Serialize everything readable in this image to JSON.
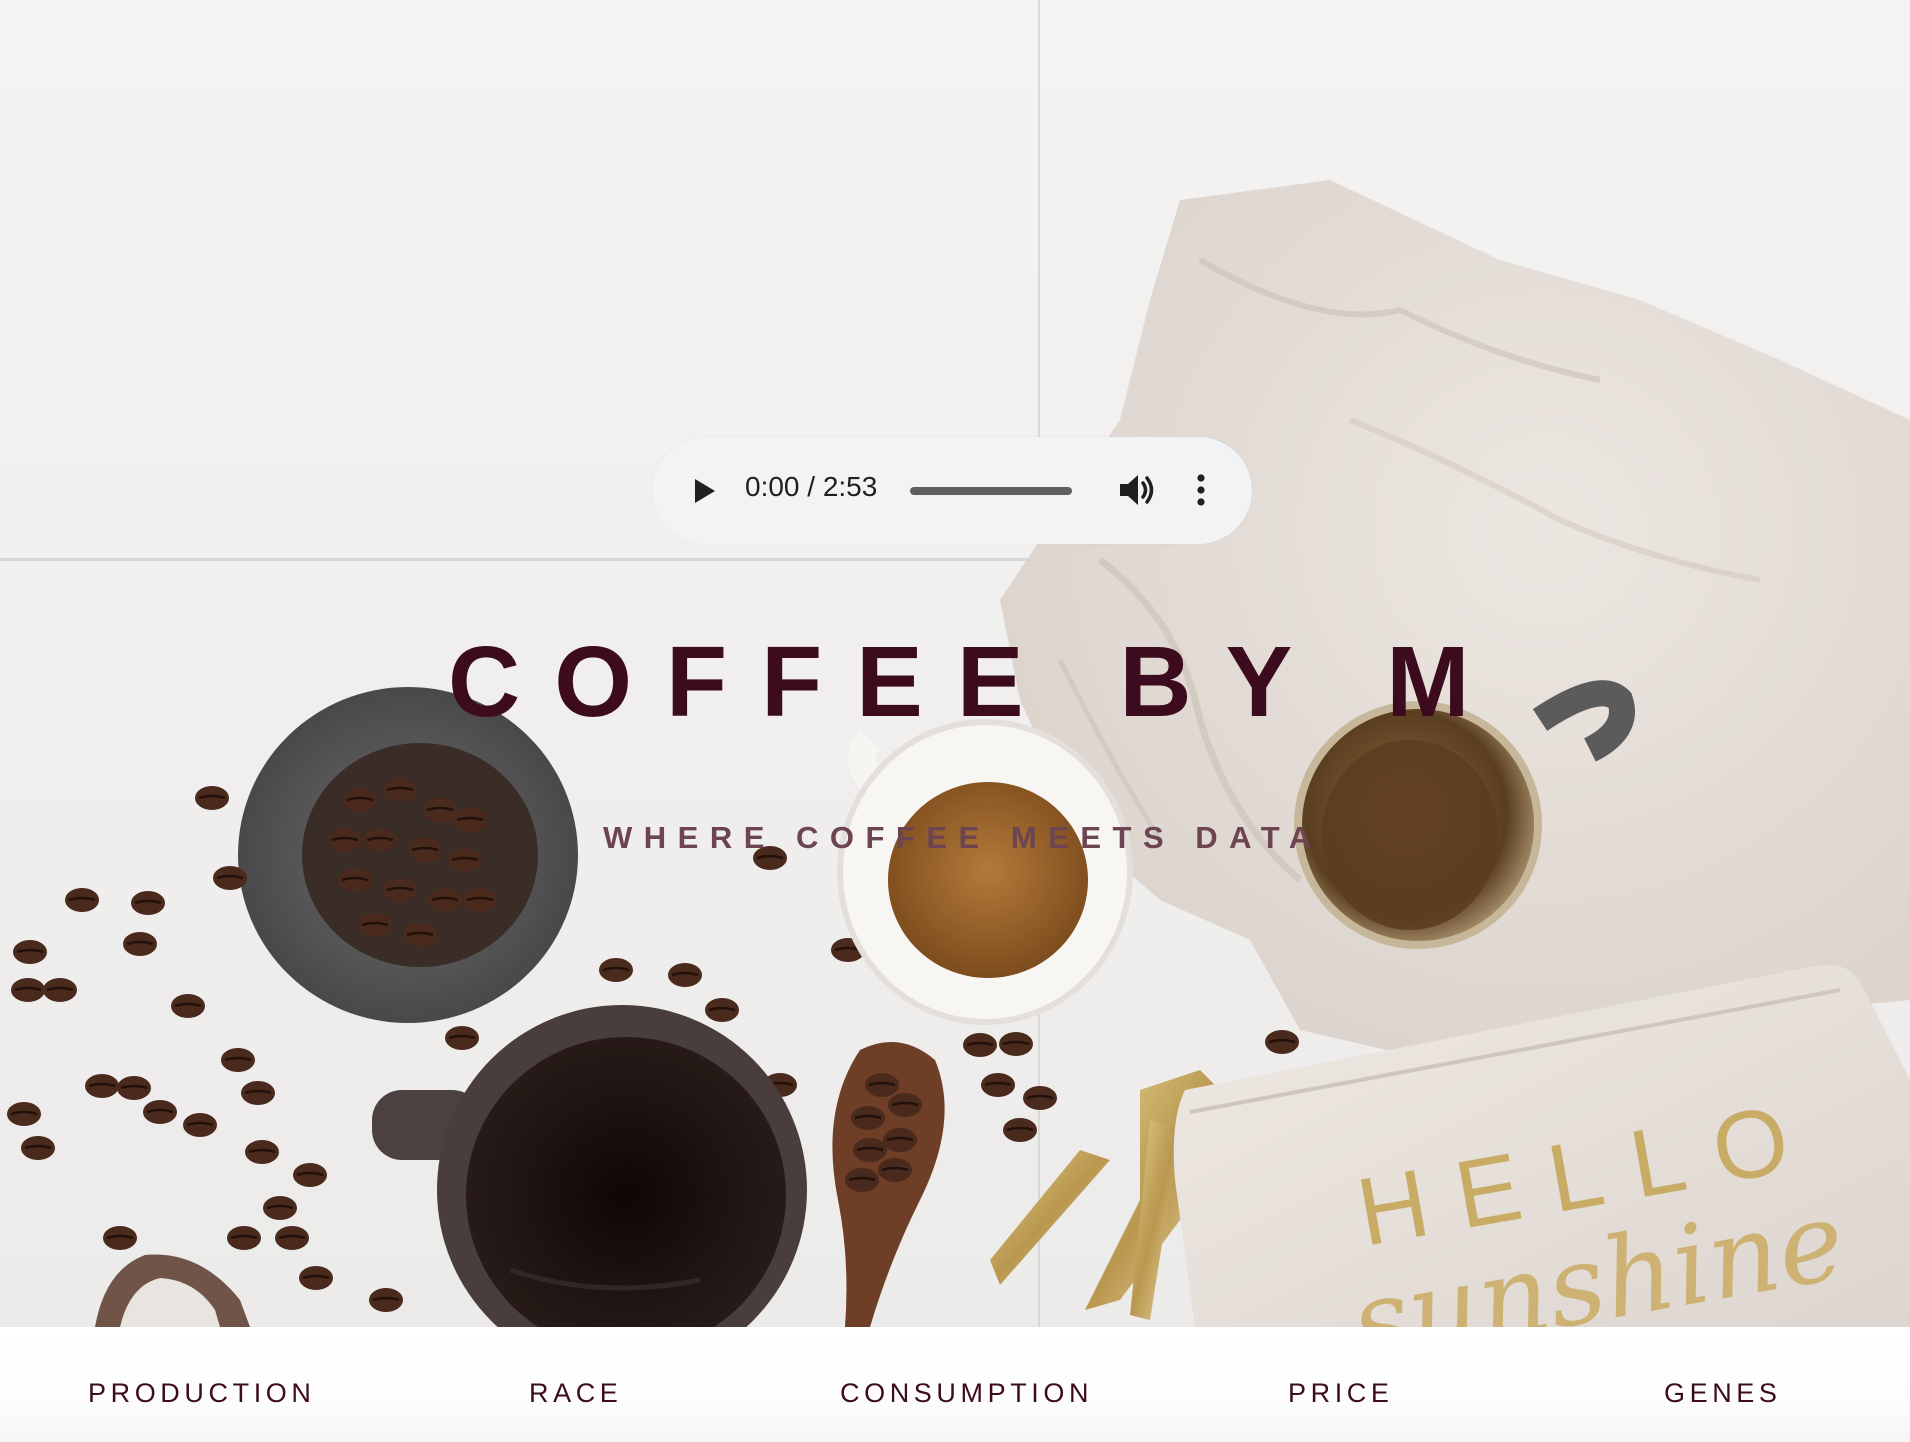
{
  "audio": {
    "time": "0:00 / 2:53",
    "progress": 0,
    "play_icon": "play-icon",
    "volume_icon": "volume-icon",
    "menu_icon": "more-vert-icon"
  },
  "hero": {
    "title": "COFFEE BY M",
    "tagline": "WHERE COFFEE MEETS DATA",
    "pouch_line1": "HELLO",
    "pouch_line2": "sunshine"
  },
  "nav": {
    "items": [
      {
        "label": "PRODUCTION"
      },
      {
        "label": "RACE"
      },
      {
        "label": "CONSUMPTION"
      },
      {
        "label": "PRICE"
      },
      {
        "label": "GENES"
      }
    ]
  },
  "colors": {
    "title": "#3d0b1e",
    "tagline": "#6c4452",
    "player_bg": "#f1f3f4"
  }
}
